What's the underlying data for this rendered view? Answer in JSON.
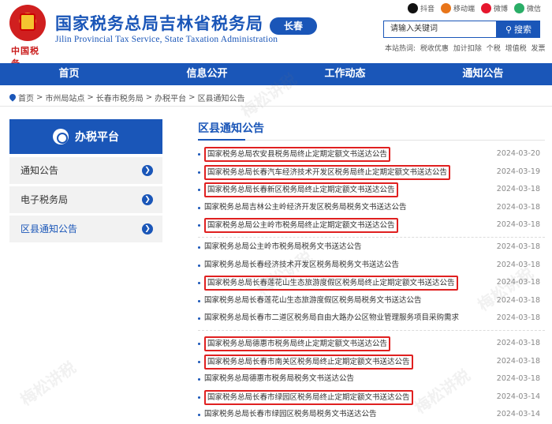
{
  "header": {
    "title": "国家税务总局吉林省税务局",
    "subtitle": "Jilin Provincial Tax Service, State Taxation Administration",
    "city": "长春",
    "emblem_text": "中国税务",
    "top_links": [
      {
        "label": "抖音",
        "icon": "tiktok-icon"
      },
      {
        "label": "移动端",
        "icon": "mobile-video-icon"
      },
      {
        "label": "微博",
        "icon": "weibo-icon"
      },
      {
        "label": "微信",
        "icon": "wechat-icon"
      }
    ],
    "search_placeholder": "请输入关键词",
    "search_button": "搜索",
    "hot_label": "本站热词:",
    "hot_words": [
      "税收优惠",
      "加计扣除",
      "个税",
      "增值税",
      "发票"
    ]
  },
  "nav": [
    "首页",
    "信息公开",
    "工作动态",
    "通知公告"
  ],
  "breadcrumb": [
    "首页",
    "市州局站点",
    "长春市税务局",
    "办税平台",
    "区县通知公告"
  ],
  "sidebar": {
    "title": "办税平台",
    "items": [
      {
        "label": "通知公告"
      },
      {
        "label": "电子税务局"
      },
      {
        "label": "区县通知公告"
      }
    ]
  },
  "main": {
    "title": "区县通知公告",
    "groups": [
      [
        {
          "title": "国家税务总局农安县税务局终止定期定额文书送达公告",
          "date": "2024-03-20",
          "highlight": true
        },
        {
          "title": "国家税务总局长春汽车经济技术开发区税务局终止定期定额文书送达公告",
          "date": "2024-03-19",
          "highlight": true
        },
        {
          "title": "国家税务总局长春新区税务局终止定期定额文书送达公告",
          "date": "2024-03-18",
          "highlight": true
        },
        {
          "title": "国家税务总局吉林公主岭经济开发区税务局税务文书送达公告",
          "date": "2024-03-18",
          "highlight": false
        },
        {
          "title": "国家税务总局公主岭市税务局终止定期定额文书送达公告",
          "date": "2024-03-18",
          "highlight": true
        }
      ],
      [
        {
          "title": "国家税务总局公主岭市税务局税务文书送达公告",
          "date": "2024-03-18",
          "highlight": false
        },
        {
          "title": "国家税务总局长春经济技术开发区税务局税务文书送达公告",
          "date": "2024-03-18",
          "highlight": false
        },
        {
          "title": "国家税务总局长春莲花山生态旅游度假区税务局终止定期定额文书送达公告",
          "date": "2024-03-18",
          "highlight": true
        },
        {
          "title": "国家税务总局长春莲花山生态旅游度假区税务局税务文书送达公告",
          "date": "2024-03-18",
          "highlight": false
        },
        {
          "title": "国家税务总局长春市二道区税务局自由大路办公区物业管理服务项目采购需求",
          "date": "2024-03-18",
          "highlight": false
        }
      ],
      [
        {
          "title": "国家税务总局德惠市税务局终止定期定额文书送达公告",
          "date": "2024-03-18",
          "highlight": true
        },
        {
          "title": "国家税务总局长春市南关区税务局终止定期定额文书送达公告",
          "date": "2024-03-18",
          "highlight": true
        },
        {
          "title": "国家税务总局德惠市税务局税务文书送达公告",
          "date": "2024-03-18",
          "highlight": false
        },
        {
          "title": "国家税务总局长春市绿园区税务局终止定期定额文书送达公告",
          "date": "2024-03-14",
          "highlight": true
        },
        {
          "title": "国家税务总局长春市绿园区税务局税务文书送达公告",
          "date": "2024-03-14",
          "highlight": false
        }
      ]
    ]
  },
  "watermark": "梅松讲税",
  "colors": {
    "brand": "#1a56b8",
    "highlight": "#e02020"
  }
}
